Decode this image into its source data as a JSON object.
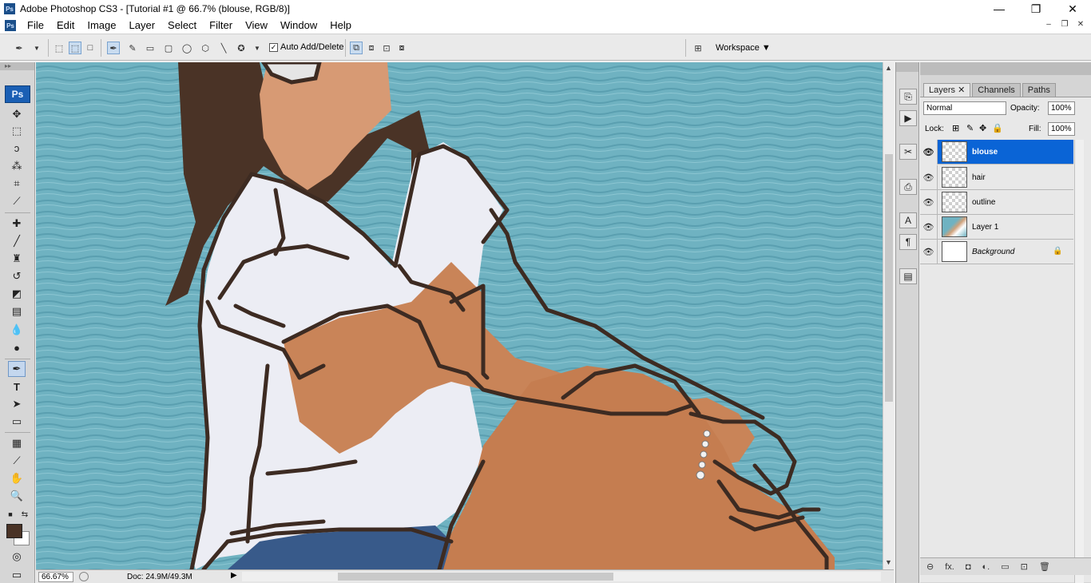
{
  "window": {
    "app_badge": "Ps",
    "title": "Adobe Photoshop CS3 - [Tutorial #1 @ 66.7% (blouse, RGB/8)]",
    "controls": {
      "minimize": "—",
      "maximize": "❐",
      "close": "✕"
    }
  },
  "menu": {
    "items": [
      "File",
      "Edit",
      "Image",
      "Layer",
      "Select",
      "Filter",
      "View",
      "Window",
      "Help"
    ],
    "doc_controls": {
      "minimize": "–",
      "restore": "❐",
      "close": "✕"
    }
  },
  "options": {
    "auto_add_delete": {
      "label": "Auto Add/Delete",
      "checked": "✓"
    },
    "workspace_label": "Workspace ▼"
  },
  "toolbox": {
    "logo": "Ps",
    "fg_color": "#4a3326",
    "bg_color": "#ffffff"
  },
  "status": {
    "zoom": "66.67%",
    "doc_size": "Doc: 24.9M/49.3M"
  },
  "panel": {
    "tabs": [
      "Layers ✕",
      "Channels",
      "Paths"
    ],
    "blend_mode": "Normal",
    "opacity_label": "Opacity:",
    "opacity_value": "100%",
    "lock_label": "Lock:",
    "fill_label": "Fill:",
    "fill_value": "100%",
    "layers": [
      {
        "name": "blouse",
        "selected": true
      },
      {
        "name": "hair"
      },
      {
        "name": "outline"
      },
      {
        "name": "Layer 1"
      },
      {
        "name": "Background",
        "locked": true
      }
    ],
    "bottom_icons": [
      "link-icon",
      "fx-icon",
      "mask-icon",
      "adjustment-icon",
      "group-icon",
      "new-layer-icon",
      "trash-icon"
    ],
    "bottom_labels": [
      "⊖",
      "fx.",
      "◘",
      "◐.",
      "▭",
      "⊡",
      "🗑"
    ]
  },
  "colors": {
    "selection": "#0a64d6",
    "canvas_water": "#6fb2c1",
    "outline_stroke": "#3d2b22",
    "hair": "#4a3326"
  }
}
